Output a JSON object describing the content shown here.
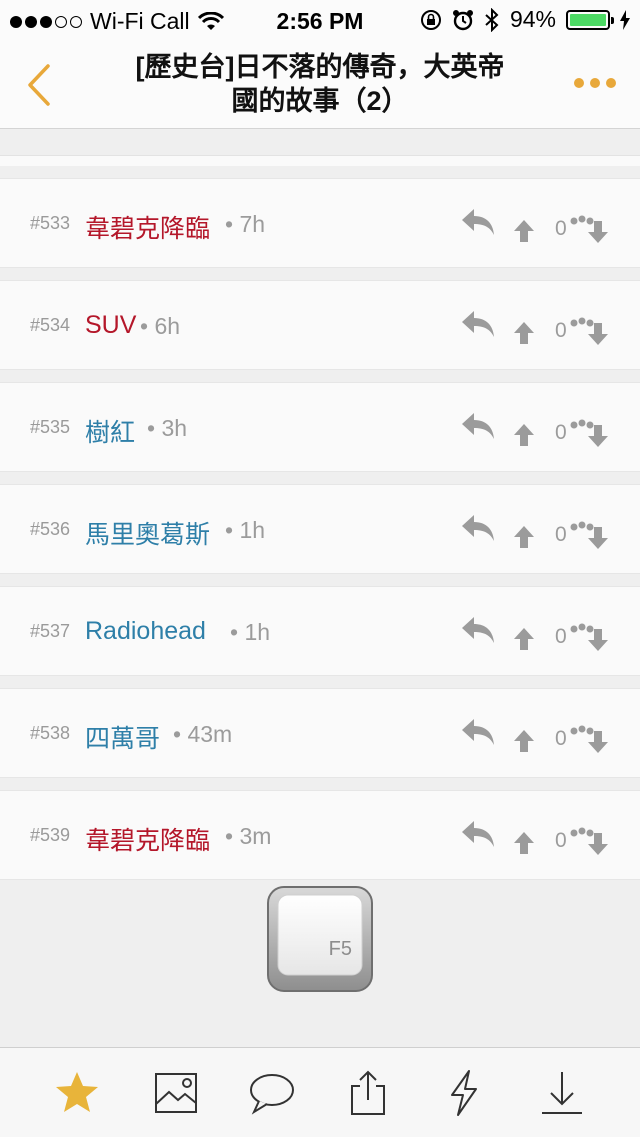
{
  "status_bar": {
    "carrier": "Wi-Fi Call",
    "time": "2:56 PM",
    "battery": "94%",
    "signal_dots_filled": 3,
    "signal_dots_total": 5
  },
  "nav": {
    "title_line1": "[歷史台]日不落的傳奇，大英帝",
    "title_line2": "國的故事（2）",
    "accent_color": "#e8a83a"
  },
  "rows": [
    {
      "num": "#533",
      "author": "韋碧克降臨",
      "time": "• 7h",
      "count": "0",
      "author_color": "red"
    },
    {
      "num": "#534",
      "author": "SUV",
      "time": "• 6h",
      "count": "0",
      "author_color": "red"
    },
    {
      "num": "#535",
      "author": "樹紅",
      "time": "• 3h",
      "count": "0",
      "author_color": "blue"
    },
    {
      "num": "#536",
      "author": "馬里奧葛斯",
      "time": "• 1h",
      "count": "0",
      "author_color": "blue"
    },
    {
      "num": "#537",
      "author": "Radiohead",
      "time": "• 1h",
      "count": "0",
      "author_color": "blue"
    },
    {
      "num": "#538",
      "author": "四萬哥",
      "time": "• 43m",
      "count": "0",
      "author_color": "blue"
    },
    {
      "num": "#539",
      "author": "韋碧克降臨",
      "time": "• 3m",
      "count": "0",
      "author_color": "red"
    }
  ],
  "refresh_key": {
    "label": "F5"
  },
  "tabbar": {
    "items": [
      "star-icon",
      "image-icon",
      "chat-bubble-icon",
      "share-icon",
      "lightning-icon",
      "download-icon"
    ]
  }
}
